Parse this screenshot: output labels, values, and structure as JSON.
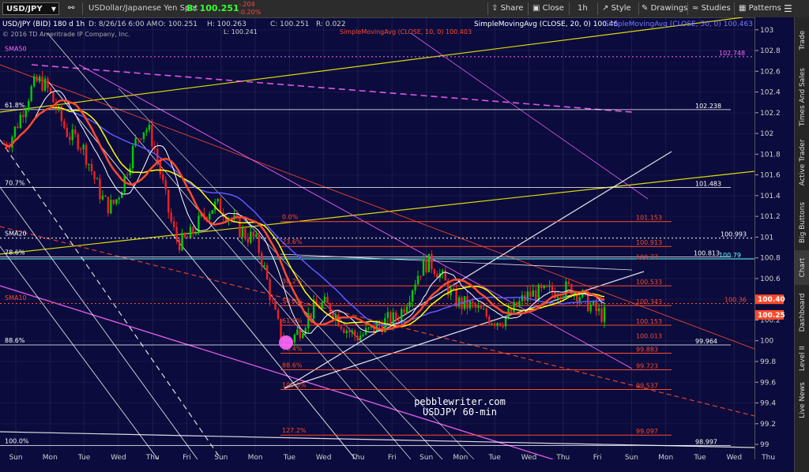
{
  "toolbar": {
    "symbol": "USD/JPY",
    "description": "USDollar/Japanese Yen Spot",
    "bid": "B: 100.251",
    "change": "-.204",
    "change_pct": "-0.20%",
    "actions": [
      "Share",
      "Close",
      "1h",
      "Style",
      "Drawings",
      "Studies",
      "Patterns"
    ]
  },
  "header": {
    "line1": "USD/JPY (BID) 180 d 1h",
    "date": "D: 8/26/16 6:00 AM",
    "open": "O: 100.251",
    "high": "H: 100.263",
    "low": "L: 100.241",
    "close": "C: 100.251",
    "range": "R: 0.022",
    "sma10": "SimpleMovingAvg (CLOSE, 10, 0) 100.403",
    "sma20": "SimpleMovingAvg (CLOSE, 20, 0) 100.46",
    "sma50": "SimpleMovingAvg (CLOSE, 50, 0) 100.463",
    "copyright": "© 2016 TD Ameritrade IP Company, Inc."
  },
  "colors": {
    "background": "#0b0b3d",
    "sma10": "#ff4a2a",
    "sma20": "#ffffff",
    "sma50": "#ffff00",
    "sma100": "#5a5aff",
    "fib": "#ff4a2a",
    "magenta": "#ff66ff",
    "up": "#00cc00",
    "down": "#ee2222"
  },
  "watermark": {
    "site": "pebblewriter.com",
    "label": "USDJPY 60-min"
  },
  "sidebar": [
    "Trade",
    "Times And Sales",
    "Active Trader",
    "Big Buttons",
    "Chart",
    "Dashboard",
    "Level II",
    "Live News"
  ],
  "chart_data": {
    "type": "candlestick",
    "xlabel": "",
    "ylabel": "",
    "ylim": [
      98.97,
      103.12
    ],
    "y_ticks": [
      "103",
      "102.8",
      "102.6",
      "102.4",
      "102.2",
      "102",
      "101.8",
      "101.6",
      "101.4",
      "101.2",
      "101",
      "100.8",
      "100.6",
      "100.4",
      "100.2",
      "100",
      "99.8",
      "99.6",
      "99.4",
      "99.2",
      "99"
    ],
    "x_ticks": [
      "Sun",
      "Mon",
      "Tue",
      "Wed",
      "Thu",
      "Fri",
      "Sun",
      "Mon",
      "Tue",
      "Wed",
      "Thu",
      "Fri",
      "Sun",
      "Mon",
      "Tue",
      "Wed",
      "Thu",
      "Fri",
      "Sun",
      "Mon",
      "Tue",
      "Wed",
      "Thu"
    ],
    "price_series": [
      {
        "day": "Sun",
        "value": 101.9
      },
      {
        "day": "Mon",
        "value": 102.5
      },
      {
        "day": "Tue",
        "value": 101.95
      },
      {
        "day": "Wed",
        "value": 101.3
      },
      {
        "day": "Thu",
        "value": 102.05
      },
      {
        "day": "Fri",
        "value": 100.95
      },
      {
        "day": "Sun",
        "value": 101.3
      },
      {
        "day": "Mon",
        "value": 101.0
      },
      {
        "day": "Tue",
        "value": 100.0
      },
      {
        "day": "Wed",
        "value": 100.35
      },
      {
        "day": "Thu",
        "value": 100.05
      },
      {
        "day": "Fri",
        "value": 100.2
      },
      {
        "day": "Sun",
        "value": 100.75
      },
      {
        "day": "Mon",
        "value": 100.35
      },
      {
        "day": "Tue",
        "value": 100.2
      },
      {
        "day": "Wed",
        "value": 100.45
      },
      {
        "day": "Thu",
        "value": 100.5
      },
      {
        "day": "Fri",
        "value": 100.25
      }
    ],
    "fib_levels_left": [
      {
        "label": "61.8%",
        "value": 102.23
      },
      {
        "label": "70.7%",
        "value": 101.48
      },
      {
        "label": "78.6%",
        "value": 100.81
      },
      {
        "label": "88.6%",
        "value": 99.96
      },
      {
        "label": "100.0%",
        "value": 98.99
      }
    ],
    "fib_levels_right": [
      {
        "label": "0.0%",
        "value": 101.15
      },
      {
        "label": "23.6%",
        "value": 100.91
      },
      {
        "label": "38.2%",
        "value": 100.53
      },
      {
        "label": "50.0%",
        "value": 100.34
      },
      {
        "label": "61.8%",
        "value": 100.15
      },
      {
        "label": "76.4%",
        "value": 99.88
      },
      {
        "label": "88.6%",
        "value": 99.72
      },
      {
        "label": "100.0%",
        "value": 99.53
      },
      {
        "label": "127.2%",
        "value": 99.09
      }
    ],
    "right_labels": [
      {
        "text": "102.748",
        "value": 102.74,
        "color": "#ff66ff"
      },
      {
        "text": "102.238",
        "value": 102.23,
        "color": "#ffffff"
      },
      {
        "text": "101.483",
        "value": 101.48,
        "color": "#ffffff"
      },
      {
        "text": "101.153",
        "value": 101.15,
        "color": "#ff4a2a"
      },
      {
        "text": "100.993",
        "value": 100.99,
        "color": "#ffffff"
      },
      {
        "text": "100.913",
        "value": 100.91,
        "color": "#ff4a2a"
      },
      {
        "text": "100.813",
        "value": 100.81,
        "color": "#ffffff"
      },
      {
        "text": "100.77",
        "value": 100.77,
        "color": "#ff4a2a"
      },
      {
        "text": "100.79",
        "value": 100.79,
        "color": "#66ffff"
      },
      {
        "text": "100.533",
        "value": 100.53,
        "color": "#ff4a2a"
      },
      {
        "text": "100.36",
        "value": 100.36,
        "color": "#ff4a2a"
      },
      {
        "text": "100.343",
        "value": 100.34,
        "color": "#ff4a2a"
      },
      {
        "text": "100.153",
        "value": 100.15,
        "color": "#ff4a2a"
      },
      {
        "text": "100.013",
        "value": 100.01,
        "color": "#ff4a2a"
      },
      {
        "text": "99.964",
        "value": 99.96,
        "color": "#ffffff"
      },
      {
        "text": "99.883",
        "value": 99.88,
        "color": "#ff4a2a"
      },
      {
        "text": "99.723",
        "value": 99.72,
        "color": "#ff4a2a"
      },
      {
        "text": "99.537",
        "value": 99.53,
        "color": "#ff4a2a"
      },
      {
        "text": "99.097",
        "value": 99.09,
        "color": "#ff4a2a"
      },
      {
        "text": "98.997",
        "value": 98.99,
        "color": "#ffffff"
      }
    ],
    "sma_labels": [
      {
        "text": "SMA50",
        "value": 102.78
      },
      {
        "text": "SMA20",
        "value": 101.0
      },
      {
        "text": "SMA10",
        "value": 100.38
      }
    ],
    "price_tags": [
      {
        "text": "100.40",
        "value": 100.4,
        "color": "#ff4a2a"
      },
      {
        "text": "100.25",
        "value": 100.25,
        "color": "#ff4a2a"
      }
    ]
  }
}
